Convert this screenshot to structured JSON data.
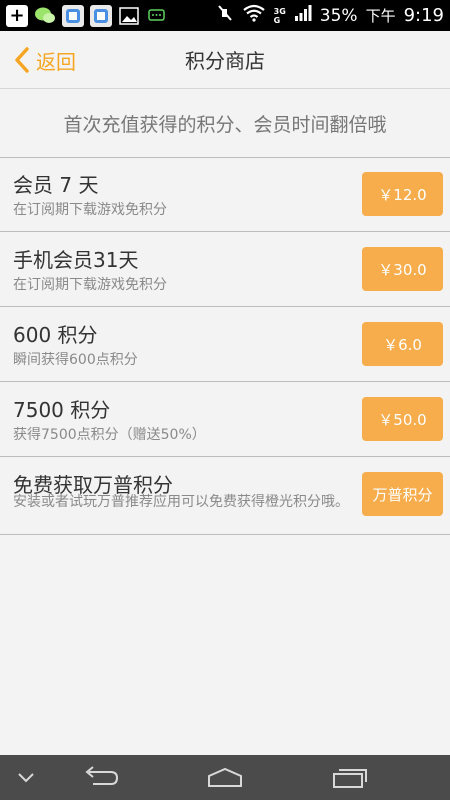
{
  "statusbar": {
    "battery": "35%",
    "ampm": "下午",
    "time": "9:19",
    "network_top": "3G",
    "network_bottom": "G"
  },
  "header": {
    "back_label": "返回",
    "title": "积分商店"
  },
  "banner": {
    "text": "首次充值获得的积分、会员时间翻倍哦"
  },
  "items": [
    {
      "title": "会员 7 天",
      "desc": "在订阅期下载游戏免积分",
      "button": "￥12.0"
    },
    {
      "title": "手机会员31天",
      "desc": "在订阅期下载游戏免积分",
      "button": "￥30.0"
    },
    {
      "title": "600 积分",
      "desc": "瞬间获得600点积分",
      "button": "￥6.0"
    },
    {
      "title": "7500 积分",
      "desc": "获得7500点积分（赠送50%）",
      "button": "￥50.0"
    },
    {
      "title": "免费获取万普积分",
      "desc": "安装或者试玩万普推荐应用可以免费获得橙光积分哦。",
      "button": "万普积分"
    }
  ],
  "colors": {
    "accent": "#f6a623",
    "button_bg": "#f7ad4c"
  }
}
